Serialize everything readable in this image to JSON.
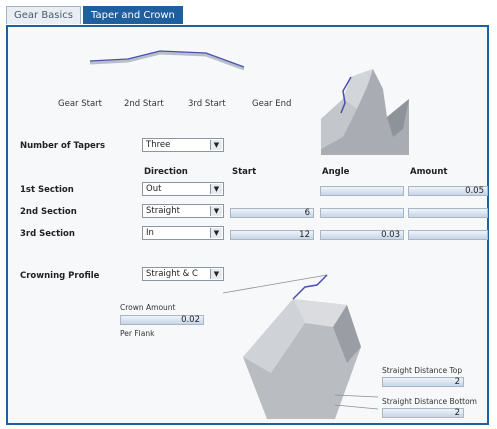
{
  "tabs": [
    {
      "label": "Gear Basics",
      "active": false
    },
    {
      "label": "Taper and Crown",
      "active": true
    }
  ],
  "taper_positions": [
    "Gear Start",
    "2nd Start",
    "3rd Start",
    "Gear End"
  ],
  "number_of_tapers": {
    "label": "Number of Tapers",
    "value": "Three"
  },
  "columns": {
    "direction": "Direction",
    "start": "Start",
    "angle": "Angle",
    "amount": "Amount"
  },
  "sections": [
    {
      "label": "1st Section",
      "direction": "Out",
      "start": "",
      "angle": "",
      "amount": "0.05"
    },
    {
      "label": "2nd Section",
      "direction": "Straight",
      "start": "6",
      "angle": "",
      "amount": ""
    },
    {
      "label": "3rd Section",
      "direction": "In",
      "start": "12",
      "angle": "0.03",
      "amount": ""
    }
  ],
  "crowning": {
    "label": "Crowning Profile",
    "value": "Straight & C",
    "crown_amount_label": "Crown Amount",
    "crown_amount_value": "0.02",
    "per_flank_label": "Per Flank"
  },
  "straight_distance": {
    "top_label": "Straight Distance Top",
    "top_value": "2",
    "bottom_label": "Straight Distance Bottom",
    "bottom_value": "2"
  },
  "colors": {
    "tab_active": "#1f5f9f",
    "profile_line": "#4a4fb0",
    "field": "#c7d5e6"
  },
  "icons": [
    "dropdown-arrow-icon"
  ]
}
